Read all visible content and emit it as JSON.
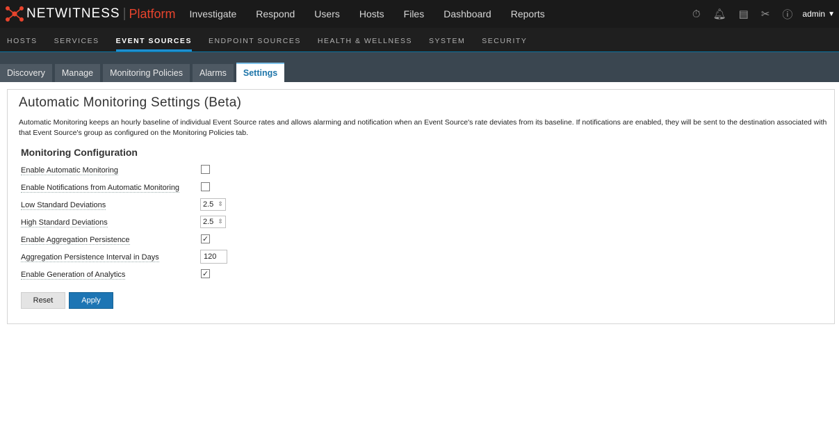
{
  "app": {
    "brand": "NETWITNESS",
    "platform": "Platform",
    "nav": [
      "Investigate",
      "Respond",
      "Users",
      "Hosts",
      "Files",
      "Dashboard",
      "Reports"
    ],
    "user": "admin",
    "icons": [
      "stopwatch-icon",
      "bell-icon",
      "notes-icon",
      "tools-icon",
      "help-icon"
    ]
  },
  "subnav": {
    "items": [
      "HOSTS",
      "SERVICES",
      "EVENT SOURCES",
      "ENDPOINT SOURCES",
      "HEALTH & WELLNESS",
      "SYSTEM",
      "SECURITY"
    ],
    "active": "EVENT SOURCES"
  },
  "tabs": {
    "items": [
      "Discovery",
      "Manage",
      "Monitoring Policies",
      "Alarms",
      "Settings"
    ],
    "active": "Settings"
  },
  "page": {
    "title": "Automatic Monitoring Settings (Beta)",
    "description": "Automatic Monitoring keeps an hourly baseline of individual Event Source rates and allows alarming and notification when an Event Source's rate deviates from its baseline. If notifications are enabled, they will be sent to the destination associated with that Event Source's group as configured on the Monitoring Policies tab.",
    "section_title": "Monitoring Configuration",
    "fields": {
      "enable_auto": {
        "label": "Enable Automatic Monitoring",
        "checked": false
      },
      "enable_notif": {
        "label": "Enable Notifications from Automatic Monitoring",
        "checked": false
      },
      "low_std": {
        "label": "Low Standard Deviations",
        "value": "2.5"
      },
      "high_std": {
        "label": "High Standard Deviations",
        "value": "2.5"
      },
      "enable_agg": {
        "label": "Enable Aggregation Persistence",
        "checked": true
      },
      "agg_interval": {
        "label": "Aggregation Persistence Interval in Days",
        "value": "120"
      },
      "enable_analytics": {
        "label": "Enable Generation of Analytics",
        "checked": true
      }
    },
    "buttons": {
      "reset": "Reset",
      "apply": "Apply"
    }
  },
  "colors": {
    "accent": "#1d75b4",
    "platform_red": "#e8442d",
    "topbar": "#1a1a1a",
    "tabstrip": "#3a4650"
  }
}
